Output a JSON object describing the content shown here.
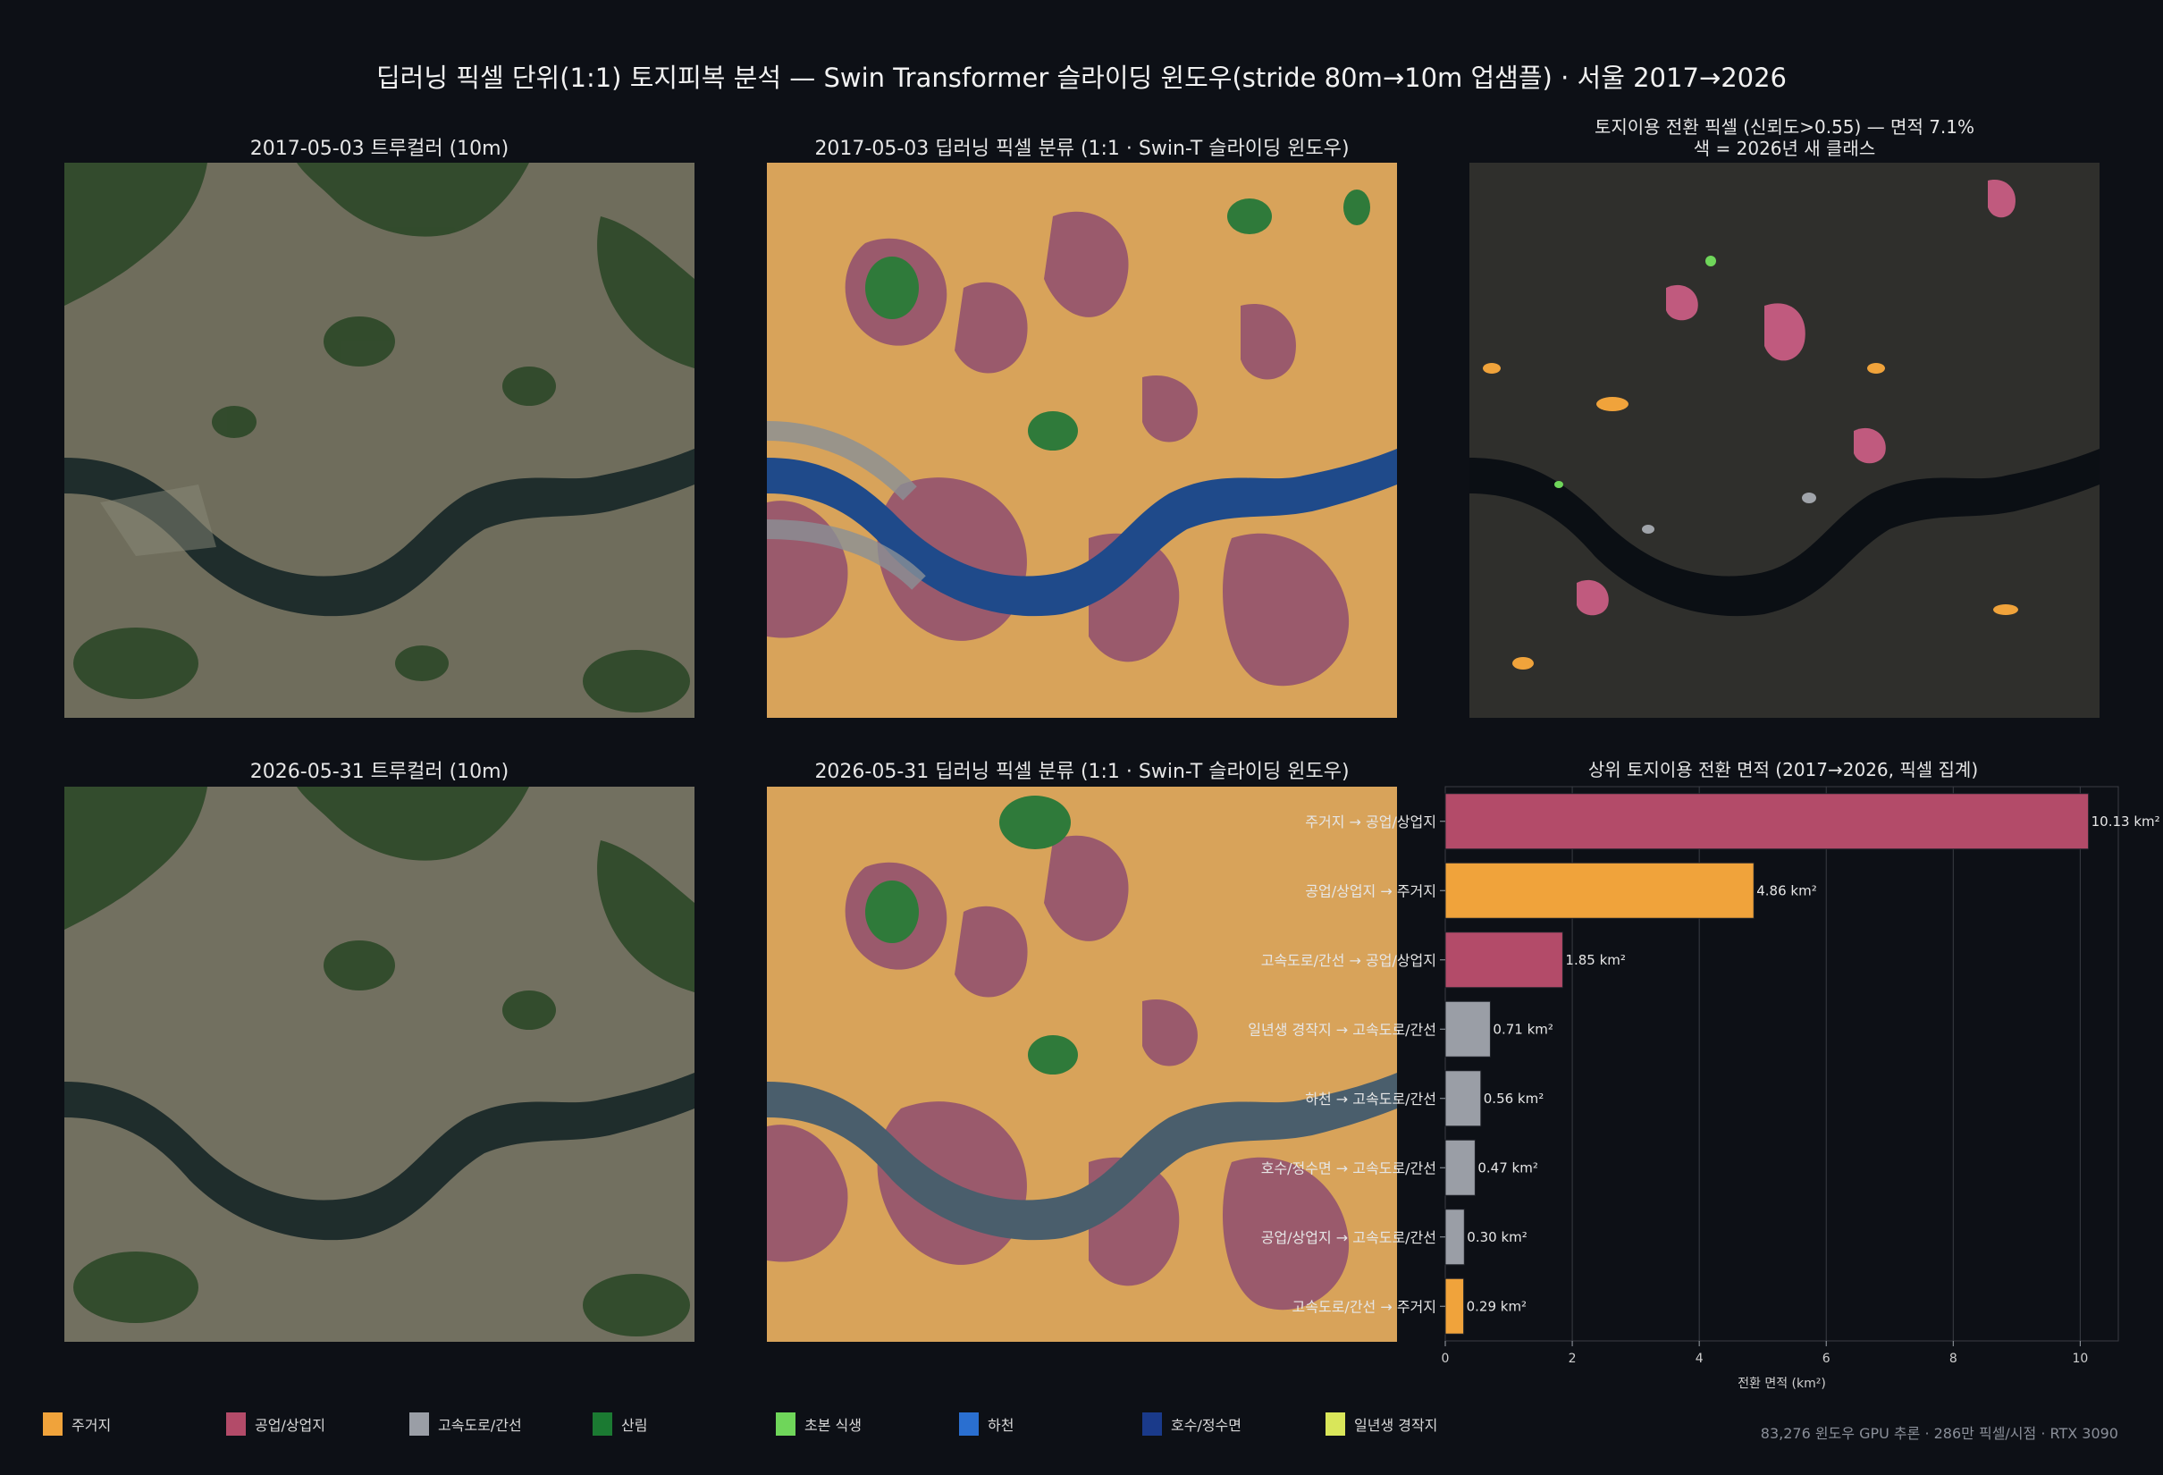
{
  "title": "딥러닝 픽셀 단위(1:1) 토지피복 분석 — Swin Transformer 슬라이딩 윈도우(stride 80m→10m 업샘플) · 서울 2017→2026",
  "panels": {
    "tc2017": "2017-05-03 트루컬러 (10m)",
    "cls2017": "2017-05-03 딥러닝 픽셀 분류 (1:1 · Swin-T 슬라이딩 윈도우)",
    "change_line1": "토지이용 전환 픽셀 (신뢰도>0.55) — 면적 7.1%",
    "change_line2": "색 = 2026년 새 클래스",
    "tc2026": "2026-05-31 트루컬러 (10m)",
    "cls2026": "2026-05-31 딥러닝 픽셀 분류 (1:1 · Swin-T 슬라이딩 윈도우)"
  },
  "colors": {
    "residential": "#f0a33b",
    "commercial": "#b34b69",
    "highway": "#9a9ea6",
    "forest": "#1b7a32",
    "grass": "#6fd65a",
    "river": "#2a6fd0",
    "lake": "#1a3a8a",
    "crop": "#d9e65a",
    "background": "#0d1016"
  },
  "legend": [
    {
      "label": "주거지",
      "color": "#f0a33b"
    },
    {
      "label": "공업/상업지",
      "color": "#b34b69"
    },
    {
      "label": "고속도로/간선",
      "color": "#9a9ea6"
    },
    {
      "label": "산림",
      "color": "#1b7a32"
    },
    {
      "label": "초본 식생",
      "color": "#6fd65a"
    },
    {
      "label": "하천",
      "color": "#2a6fd0"
    },
    {
      "label": "호수/정수면",
      "color": "#1a3a8a"
    },
    {
      "label": "일년생 경작지",
      "color": "#d9e65a"
    }
  ],
  "footer": "83,276 윈도우 GPU 추론 · 286만 픽셀/시점 · RTX 3090",
  "chart_data": {
    "type": "bar",
    "orientation": "horizontal",
    "title": "상위 토지이용 전환 면적 (2017→2026, 픽셀 집계)",
    "xlabel": "전환 면적 (km²)",
    "xlim": [
      0,
      10.6
    ],
    "xticks": [
      0,
      2,
      4,
      6,
      8,
      10
    ],
    "grid": true,
    "categories": [
      "주거지 → 공업/상업지",
      "공업/상업지 → 주거지",
      "고속도로/간선 → 공업/상업지",
      "일년생 경작지 → 고속도로/간선",
      "하천 → 고속도로/간선",
      "호수/정수면 → 고속도로/간선",
      "공업/상업지 → 고속도로/간선",
      "고속도로/간선 → 주거지"
    ],
    "values": [
      10.13,
      4.86,
      1.85,
      0.71,
      0.56,
      0.47,
      0.3,
      0.29
    ],
    "value_labels": [
      "10.13 km²",
      "4.86 km²",
      "1.85 km²",
      "0.71 km²",
      "0.56 km²",
      "0.47 km²",
      "0.30 km²",
      "0.29 km²"
    ],
    "bar_colors": [
      "#b34b69",
      "#f0a33b",
      "#b34b69",
      "#9a9ea6",
      "#9a9ea6",
      "#9a9ea6",
      "#9a9ea6",
      "#f0a33b"
    ]
  }
}
